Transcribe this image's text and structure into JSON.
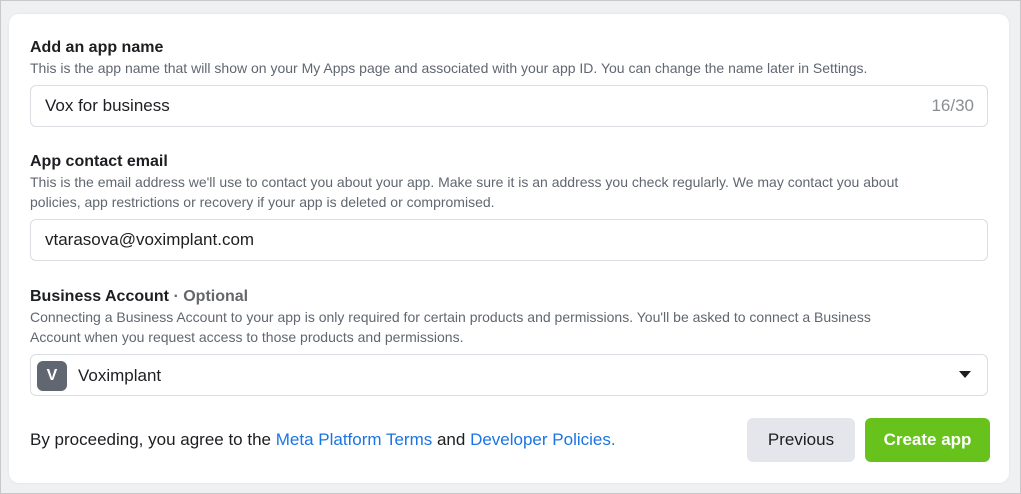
{
  "app_name": {
    "label": "Add an app name",
    "description": "This is the app name that will show on your My Apps page and associated with your app ID. You can change the name later in Settings.",
    "value": "Vox for business",
    "counter": "16/30"
  },
  "contact_email": {
    "label": "App contact email",
    "description_line1": "This is the email address we'll use to contact you about your app. Make sure it is an address you check regularly. We may contact you about",
    "description_line2": "policies, app restrictions or recovery if your app is deleted or compromised.",
    "value": "vtarasova@voximplant.com"
  },
  "business_account": {
    "label": "Business Account",
    "optional": "· Optional",
    "description_line1": "Connecting a Business Account to your app is only required for certain products and permissions. You'll be asked to connect a Business",
    "description_line2": "Account when you request access to those products and permissions.",
    "avatar_letter": "V",
    "selected": "Voximplant"
  },
  "footer": {
    "prefix": "By proceeding, you agree to the ",
    "terms_link": "Meta Platform Terms",
    "conjunction": " and ",
    "policies_link": "Developer Policies",
    "suffix": "."
  },
  "buttons": {
    "previous": "Previous",
    "create": "Create app"
  },
  "colors": {
    "accent_green": "#67c21b",
    "link_blue": "#1b74e4"
  }
}
